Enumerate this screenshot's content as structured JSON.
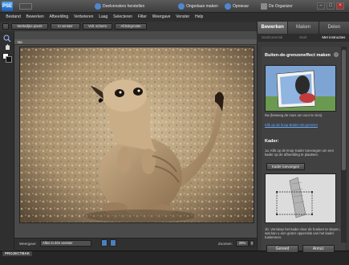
{
  "titlebar": {
    "logo": "PSE",
    "items": [
      {
        "label": "Deelvensters herstellen",
        "icon": "restore-panels-icon"
      },
      {
        "label": "Ongedaan maken",
        "icon": "undo-icon"
      },
      {
        "label": "Opnieuw",
        "icon": "redo-icon"
      },
      {
        "label": "De Organizer",
        "icon": "organizer-icon"
      }
    ],
    "win_min": "–",
    "win_max": "□",
    "win_close": "×"
  },
  "menu": [
    "Bestand",
    "Bewerken",
    "Afbeelding",
    "Verbeteren",
    "Laag",
    "Selecteren",
    "Filter",
    "Weergave",
    "Venster",
    "Help"
  ],
  "viewbar": [
    "Werkelijke pixels",
    "In venster",
    "Volt. scherm",
    "Afdrukgrootte"
  ],
  "panel_tabs": [
    "Bewerken",
    "Maken",
    "Delen"
  ],
  "subtabs": [
    "Snelcorrectie",
    "Snel",
    "Met instructies"
  ],
  "document": {
    "title": "Ne"
  },
  "guide": {
    "title": "Buiten-de-grenzeneffect maken",
    "help": "?",
    "hint": "Als u de voorbeelden wilt zien, beweegt u de muis over deze voorbeelden.",
    "hint_short": "Na (beweeg de muis om voor te zien)",
    "link": "Klik op de knop Buiten-de-grenzen",
    "kader_heading": "Kader:",
    "kader_step": "1a. Klik op de knop Kader toevoegen om een kader op de afbeelding te plaatsen.",
    "kader_button": "Kader toevoegen",
    "step_two": "1b. Versleep het kader door de hoeken te slepen, wat kan u een groter oppervlak van het kader toekennen.",
    "done": "Gereed",
    "cancel": "Annul."
  },
  "bottombar": {
    "arrange_label": "Weergave:",
    "arrange_value": "Alles in één venster",
    "zoom_label": "Zoomen:",
    "zoom_value": "28%"
  },
  "projectbin": "PROJECTBAK",
  "colors": {
    "accent": "#2a7ad5",
    "link": "#6aa8ff"
  }
}
